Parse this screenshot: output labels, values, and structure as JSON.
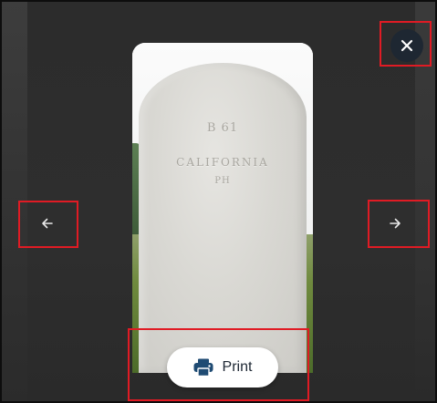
{
  "viewer": {
    "photo_alt": "headstone photo",
    "headstone": {
      "line1": "B 61",
      "line2": "CALIFORNIA",
      "line3": "PH"
    }
  },
  "controls": {
    "close": {
      "icon": "close-icon",
      "glyph": "✕"
    },
    "previous": {
      "icon": "arrow-left-icon",
      "glyph": "←"
    },
    "next": {
      "icon": "arrow-right-icon",
      "glyph": "→"
    },
    "print": {
      "label": "Print",
      "icon": "printer-icon"
    }
  },
  "colors": {
    "overlay_background": "#2f2f2f",
    "close_button_background": "#1e2732",
    "print_icon": "#1f4b73",
    "print_text": "#1d2733",
    "highlight_box": "#e01b24"
  }
}
